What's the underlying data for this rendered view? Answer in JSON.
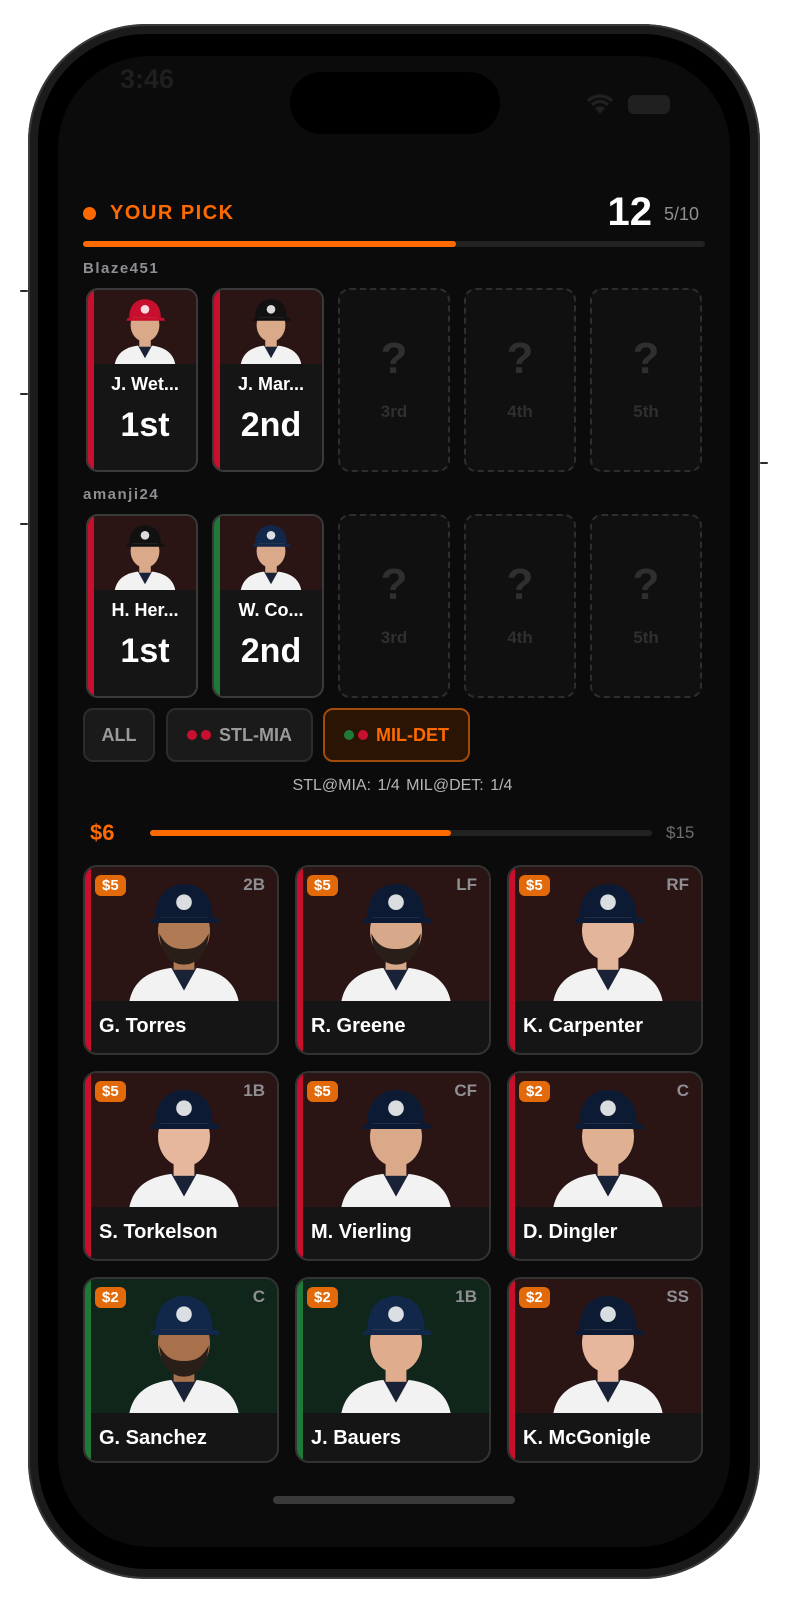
{
  "status": {
    "time": "3:46"
  },
  "header": {
    "label": "YOUR PICK",
    "timer": "12",
    "pick_count": "5/10",
    "progress": 0.6
  },
  "teams": [
    {
      "name": "Blaze451",
      "slots": [
        {
          "filled": true,
          "player": "J. Wet...",
          "rank": "1st",
          "team_color": "#c8102e",
          "cap": "#c8102e",
          "logo": "STL"
        },
        {
          "filled": true,
          "player": "J. Mar...",
          "rank": "2nd",
          "team_color": "#c8102e",
          "cap": "#111111",
          "logo": "MIA"
        },
        {
          "filled": false,
          "mark": "?",
          "rank": "3rd"
        },
        {
          "filled": false,
          "mark": "?",
          "rank": "4th"
        },
        {
          "filled": false,
          "mark": "?",
          "rank": "5th"
        }
      ]
    },
    {
      "name": "amanji24",
      "slots": [
        {
          "filled": true,
          "player": "H. Her...",
          "rank": "1st",
          "team_color": "#c8102e",
          "cap": "#111111",
          "logo": "MIA"
        },
        {
          "filled": true,
          "player": "W. Co...",
          "rank": "2nd",
          "team_color": "#1f7a3a",
          "cap": "#12284b",
          "logo": "MIL"
        },
        {
          "filled": false,
          "mark": "?",
          "rank": "3rd"
        },
        {
          "filled": false,
          "mark": "?",
          "rank": "4th"
        },
        {
          "filled": false,
          "mark": "?",
          "rank": "5th"
        }
      ]
    }
  ],
  "filters": [
    {
      "label": "ALL",
      "active": false,
      "dots": []
    },
    {
      "label": "STL-MIA",
      "active": false,
      "dots": [
        "#c8102e",
        "#c8102e"
      ]
    },
    {
      "label": "MIL-DET",
      "active": true,
      "dots": [
        "#1f7a3a",
        "#c8102e"
      ]
    }
  ],
  "matchups": "STL@MIA: 1/4    MIL@DET: 1/4",
  "budget": {
    "used": "$6",
    "max": "$15",
    "fraction": 0.6
  },
  "players": [
    {
      "price": "$5",
      "pos": "2B",
      "name": "G. Torres",
      "team_color": "#c8102e",
      "bg": "#2a1414",
      "cap": "#0c1b33",
      "skin": "#b07a55",
      "beard": true
    },
    {
      "price": "$5",
      "pos": "LF",
      "name": "R. Greene",
      "team_color": "#c8102e",
      "bg": "#2a1414",
      "cap": "#0c1b33",
      "skin": "#d7a88a",
      "beard": true
    },
    {
      "price": "$5",
      "pos": "RF",
      "name": "K. Carpenter",
      "team_color": "#c8102e",
      "bg": "#2a1414",
      "cap": "#0c1b33",
      "skin": "#e3b59a",
      "beard": false
    },
    {
      "price": "$5",
      "pos": "1B",
      "name": "S. Torkelson",
      "team_color": "#c8102e",
      "bg": "#2a1414",
      "cap": "#0c1b33",
      "skin": "#e6b79c",
      "beard": false
    },
    {
      "price": "$5",
      "pos": "CF",
      "name": "M. Vierling",
      "team_color": "#c8102e",
      "bg": "#2a1414",
      "cap": "#0c1b33",
      "skin": "#d9a98a",
      "beard": false
    },
    {
      "price": "$2",
      "pos": "C",
      "name": "D. Dingler",
      "team_color": "#c8102e",
      "bg": "#2a1414",
      "cap": "#0c1b33",
      "skin": "#e0b092",
      "beard": false
    },
    {
      "price": "$2",
      "pos": "C",
      "name": "G. Sanchez",
      "team_color": "#1f7a3a",
      "bg": "#10261a",
      "cap": "#12284b",
      "skin": "#a8714c",
      "beard": true
    },
    {
      "price": "$2",
      "pos": "1B",
      "name": "J. Bauers",
      "team_color": "#1f7a3a",
      "bg": "#10261a",
      "cap": "#12284b",
      "skin": "#e0ac8e",
      "beard": false
    },
    {
      "price": "$2",
      "pos": "SS",
      "name": "K. McGonigle",
      "team_color": "#c8102e",
      "bg": "#2a1414",
      "cap": "#0c1b33",
      "skin": "#e6b79c",
      "beard": false
    }
  ]
}
